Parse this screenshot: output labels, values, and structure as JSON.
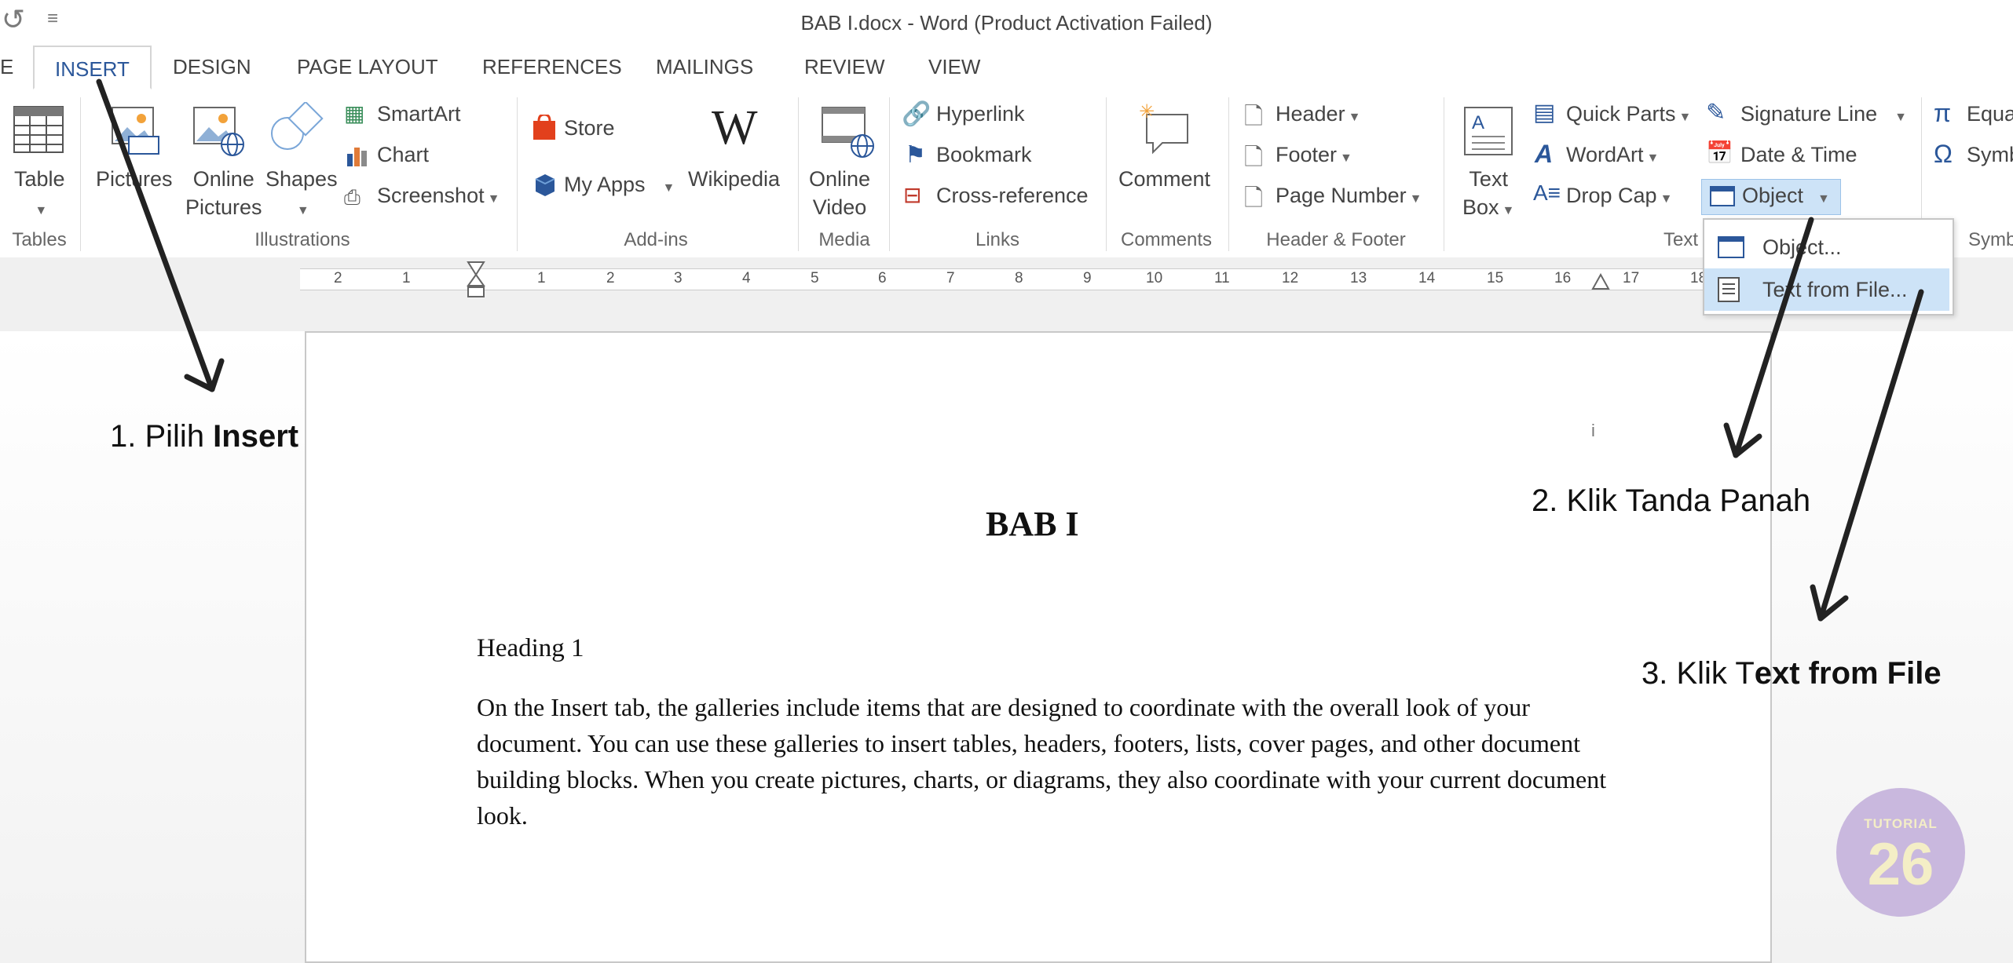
{
  "title": "BAB I.docx - Word (Product Activation Failed)",
  "tabs": [
    "E",
    "INSERT",
    "DESIGN",
    "PAGE LAYOUT",
    "REFERENCES",
    "MAILINGS",
    "REVIEW",
    "VIEW"
  ],
  "ribbon": {
    "tables": {
      "table": "Table",
      "group": "Tables"
    },
    "illustrations": {
      "pictures": "Pictures",
      "online_1": "Online",
      "online_2": "Pictures",
      "shapes": "Shapes",
      "smartart": "SmartArt",
      "chart": "Chart",
      "screenshot": "Screenshot",
      "group": "Illustrations"
    },
    "addins": {
      "store": "Store",
      "myapps": "My Apps",
      "wikipedia": "Wikipedia",
      "group": "Add-ins"
    },
    "media": {
      "online": "Online",
      "video": "Video",
      "group": "Media"
    },
    "links": {
      "hyperlink": "Hyperlink",
      "bookmark": "Bookmark",
      "crossref": "Cross-reference",
      "group": "Links"
    },
    "comments": {
      "comment": "Comment",
      "group": "Comments"
    },
    "headerfooter": {
      "header": "Header",
      "footer": "Footer",
      "pagenum": "Page Number",
      "group": "Header & Footer"
    },
    "text": {
      "textbox_1": "Text",
      "textbox_2": "Box",
      "quickparts": "Quick Parts",
      "wordart": "WordArt",
      "dropcap": "Drop Cap",
      "signature": "Signature Line",
      "datetime": "Date & Time",
      "object": "Object",
      "group": "Text"
    },
    "symbols": {
      "equation": "Equa",
      "symbol": "Symb",
      "group": "Symb"
    }
  },
  "dropdown": {
    "item1": "Object...",
    "item2": "Text from File..."
  },
  "ruler": [
    "2",
    "1",
    "1",
    "2",
    "3",
    "4",
    "5",
    "6",
    "7",
    "8",
    "9",
    "10",
    "11",
    "12",
    "13",
    "14",
    "15",
    "16",
    "17",
    "18"
  ],
  "document": {
    "marker": "i",
    "title": "BAB I",
    "heading": "Heading 1",
    "body": "On the Insert tab, the galleries include items that are designed to coordinate with the overall look of your document. You can use these galleries to insert tables, headers, footers, lists, cover pages, and other document building blocks. When you create pictures, charts, or diagrams, they also coordinate with your current document look."
  },
  "annotations": {
    "step1_prefix": "1. Pilih ",
    "step1_bold": "Insert",
    "step2": "2. Klik Tanda Panah",
    "step3_prefix": "3. Klik T",
    "step3_bold": "ext from File"
  },
  "badge": {
    "top": "TUTORIAL",
    "number": "26"
  },
  "colors": {
    "accent": "#2b579a",
    "highlight": "#cde3f7",
    "badge": "#c9b8de"
  }
}
